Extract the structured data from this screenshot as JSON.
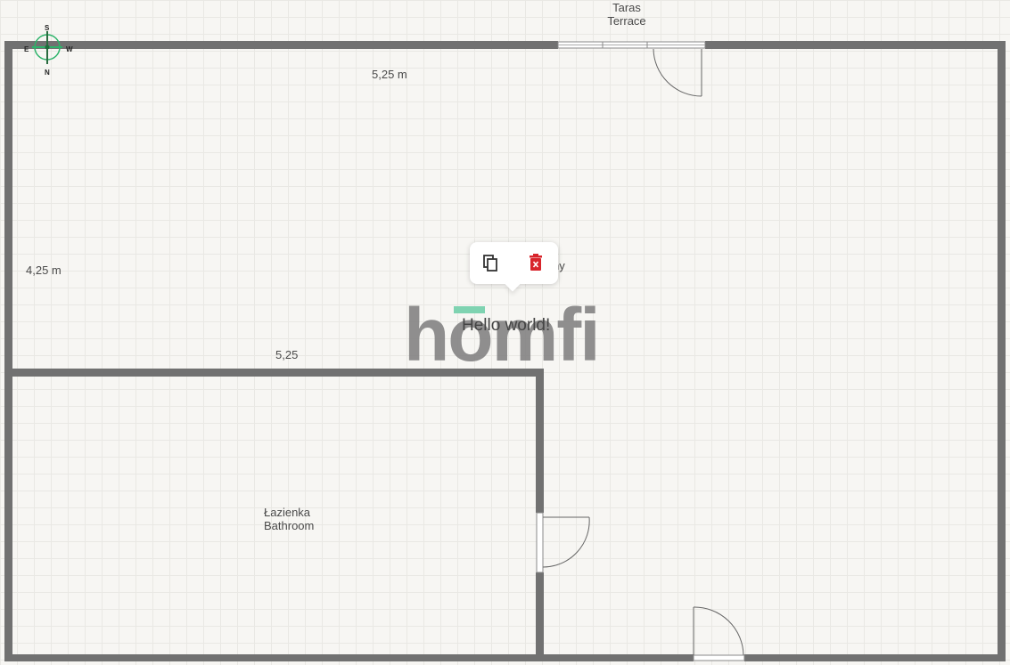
{
  "floorplan": {
    "terrace_label": [
      "Taras",
      "Terrace"
    ],
    "bathroom_label": [
      "Łazienka",
      "Bathroom"
    ],
    "dimension_top": "5,25 m",
    "dimension_left": "4,25 m",
    "dimension_partition": "5,25",
    "room_label_fragment": "ny",
    "text_object": "Hello world!"
  },
  "compass": {
    "north": "N",
    "south": "S",
    "east": "E",
    "west": "W"
  },
  "popup": {
    "copy_icon": "copy-icon",
    "delete_icon": "trash-icon",
    "delete_color": "#d8252c"
  },
  "watermark": {
    "text": "homfi",
    "accent_color": "#7fd3b1"
  },
  "colors": {
    "wall": "#717171",
    "grid": "#e9e8e4",
    "background": "#f7f6f3"
  }
}
